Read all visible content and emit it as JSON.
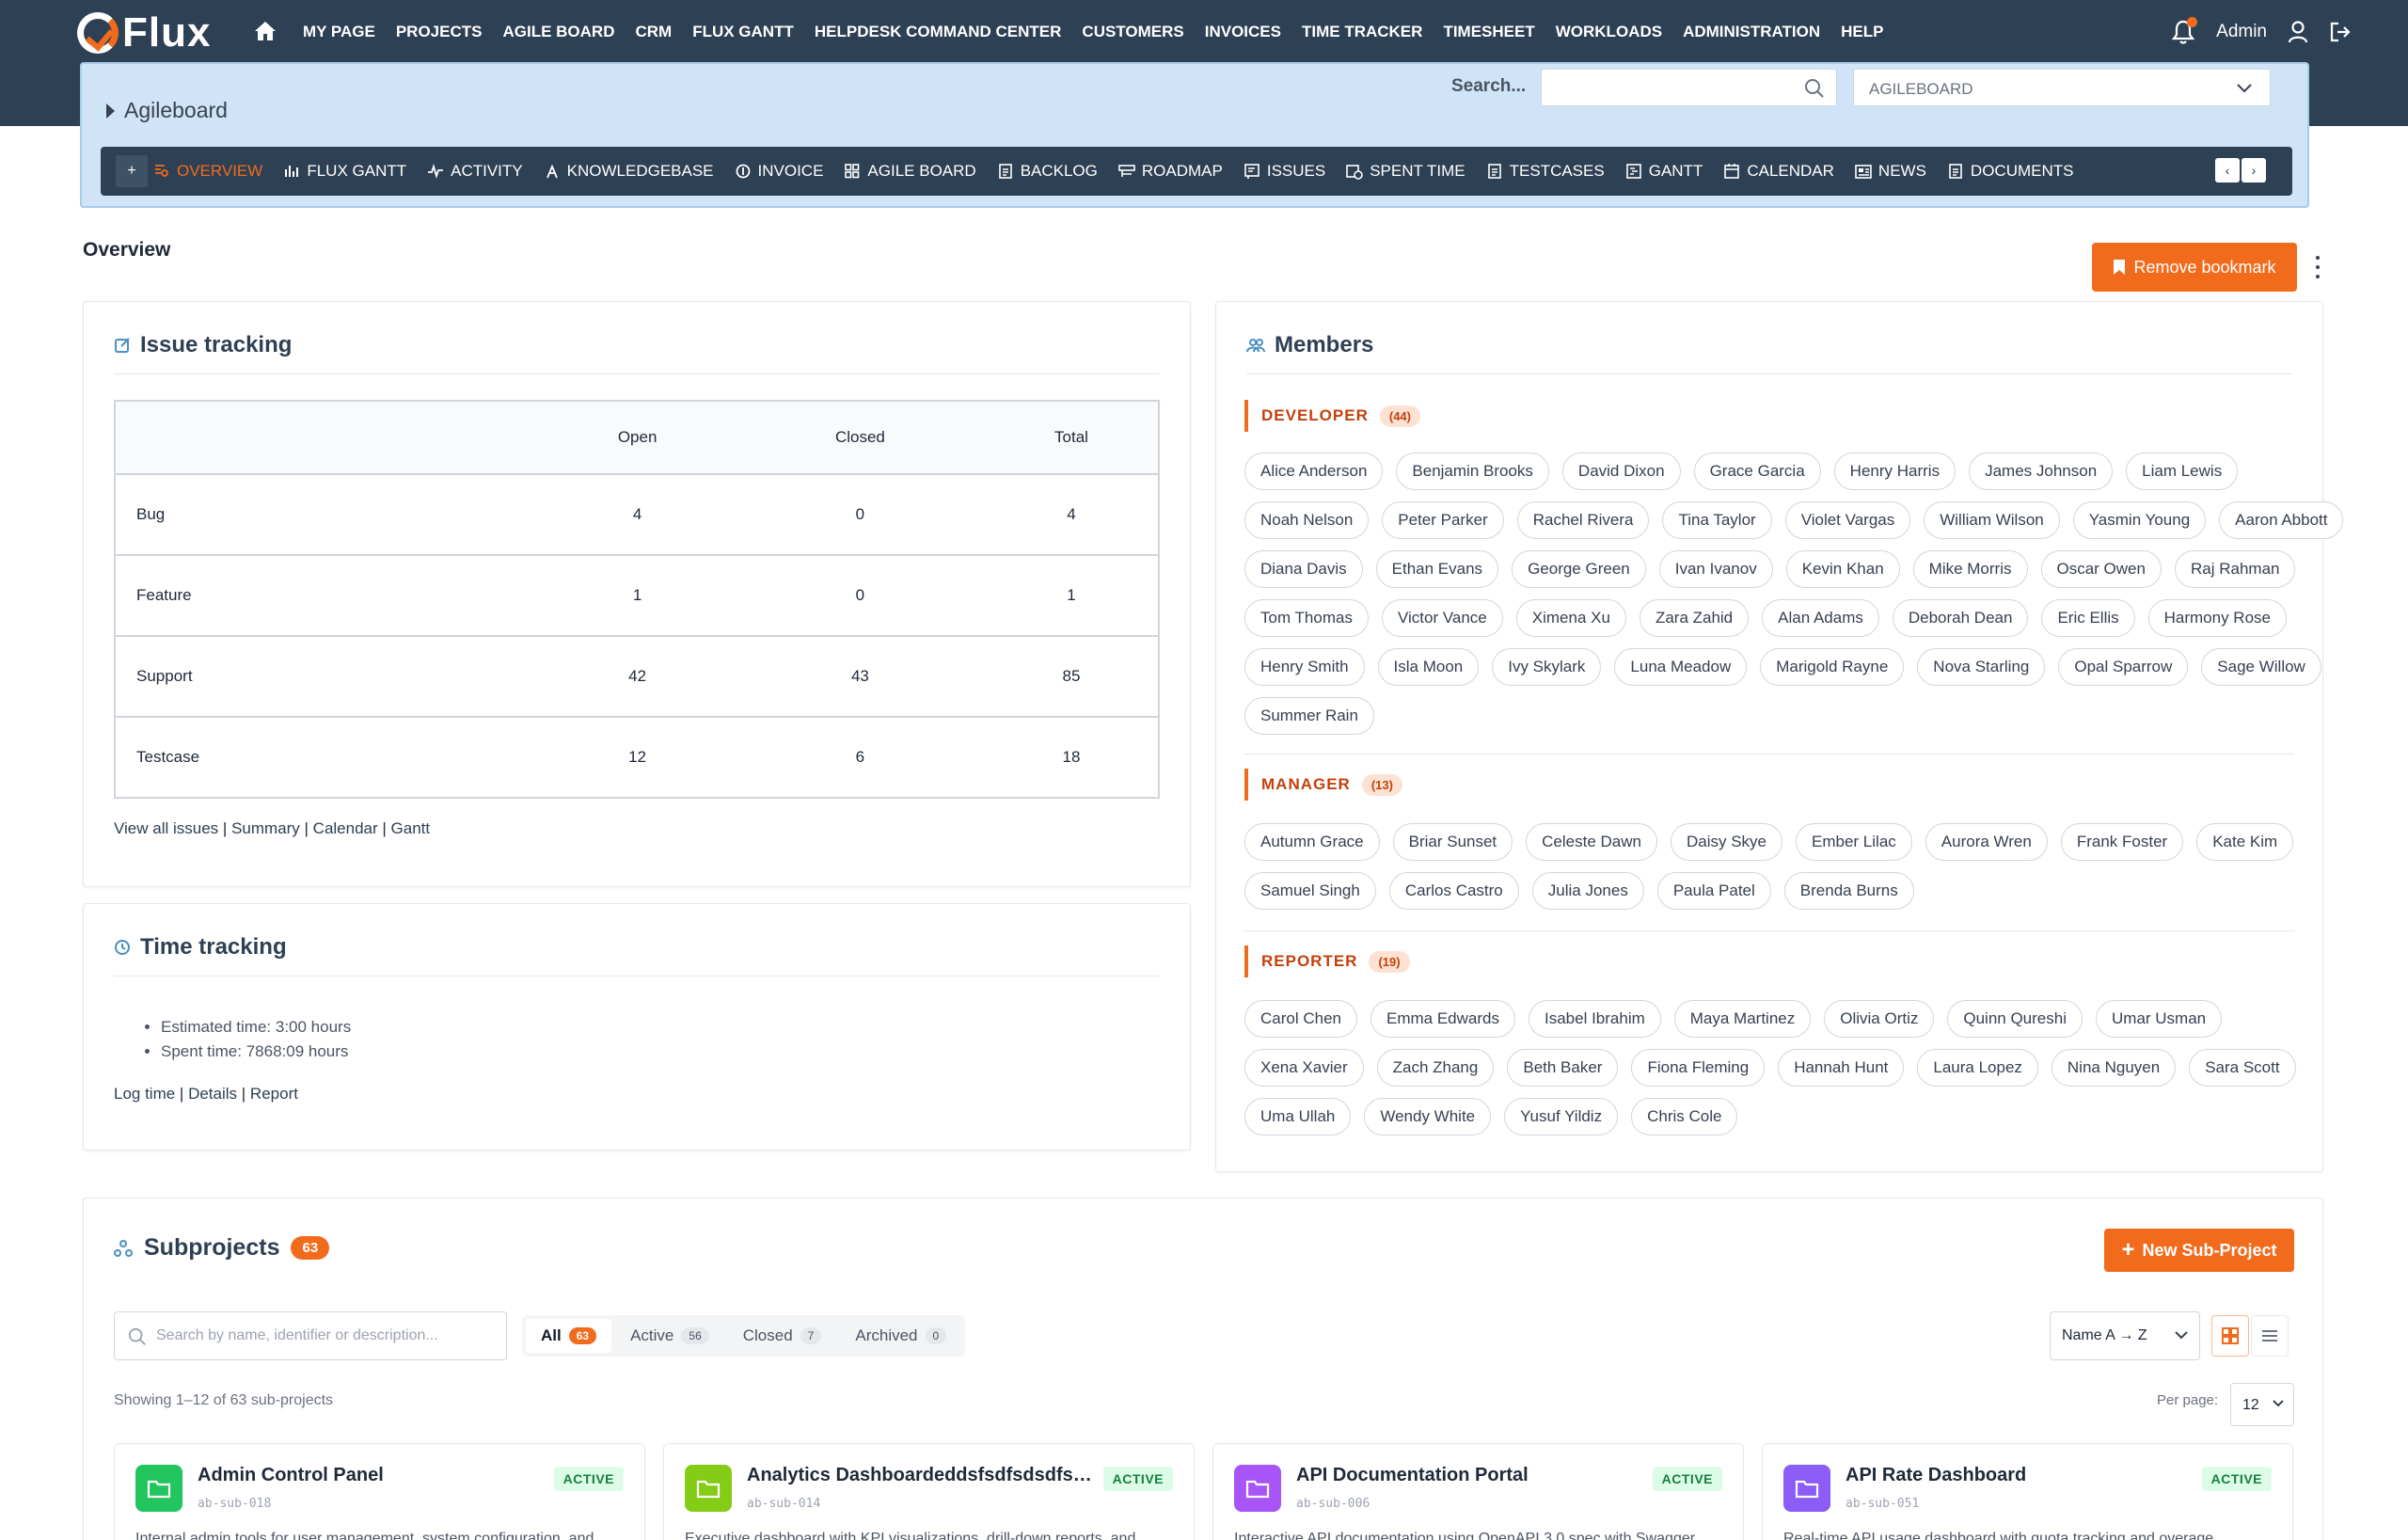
{
  "app": {
    "logo_text": "Flux"
  },
  "nav": {
    "items": [
      "MY PAGE",
      "PROJECTS",
      "AGILE BOARD",
      "CRM",
      "FLUX GANTT",
      "HELPDESK COMMAND CENTER",
      "CUSTOMERS",
      "INVOICES",
      "TIME TRACKER",
      "TIMESHEET",
      "WORKLOADS",
      "ADMINISTRATION",
      "HELP"
    ],
    "user": "Admin"
  },
  "project": {
    "breadcrumb": "Agileboard",
    "search_label": "Search...",
    "search_value": "",
    "select_value": "AGILEBOARD",
    "tabs": [
      {
        "label": "OVERVIEW",
        "icon": "overview-icon"
      },
      {
        "label": "FLUX GANTT",
        "icon": "bar-chart-icon"
      },
      {
        "label": "ACTIVITY",
        "icon": "activity-icon"
      },
      {
        "label": "KNOWLEDGEBASE",
        "icon": "knowledgebase-icon"
      },
      {
        "label": "INVOICE",
        "icon": "invoice-icon"
      },
      {
        "label": "AGILE BOARD",
        "icon": "grid-icon"
      },
      {
        "label": "BACKLOG",
        "icon": "document-icon"
      },
      {
        "label": "ROADMAP",
        "icon": "roadmap-icon"
      },
      {
        "label": "ISSUES",
        "icon": "issues-icon"
      },
      {
        "label": "SPENT TIME",
        "icon": "clock-calendar-icon"
      },
      {
        "label": "TESTCASES",
        "icon": "document-icon"
      },
      {
        "label": "GANTT",
        "icon": "gantt-icon"
      },
      {
        "label": "CALENDAR",
        "icon": "calendar-icon"
      },
      {
        "label": "NEWS",
        "icon": "news-icon"
      },
      {
        "label": "DOCUMENTS",
        "icon": "document-icon"
      }
    ],
    "active_tab": "OVERVIEW",
    "tab_plus": "+",
    "arrow_left": "‹",
    "arrow_right": "›"
  },
  "overview": {
    "title": "Overview",
    "bookmark_label": "Remove bookmark"
  },
  "issue_tracking": {
    "title": "Issue tracking",
    "columns": [
      "",
      "Open",
      "Closed",
      "Total"
    ],
    "rows": [
      {
        "type": "Bug",
        "open": "4",
        "closed": "0",
        "total": "4"
      },
      {
        "type": "Feature",
        "open": "1",
        "closed": "0",
        "total": "1"
      },
      {
        "type": "Support",
        "open": "42",
        "closed": "43",
        "total": "85"
      },
      {
        "type": "Testcase",
        "open": "12",
        "closed": "6",
        "total": "18"
      }
    ],
    "links": [
      "View all issues",
      "Summary",
      "Calendar",
      "Gantt"
    ]
  },
  "time_tracking": {
    "title": "Time tracking",
    "estimated": "Estimated time: 3:00 hours",
    "spent": "Spent time: 7868:09 hours",
    "links": [
      "Log time",
      "Details",
      "Report"
    ]
  },
  "members": {
    "title": "Members",
    "roles": [
      {
        "name": "DEVELOPER",
        "count": "(44)",
        "people": [
          "Alice Anderson",
          "Benjamin Brooks",
          "David Dixon",
          "Grace Garcia",
          "Henry Harris",
          "James Johnson",
          "Liam Lewis",
          "Noah Nelson",
          "Peter Parker",
          "Rachel Rivera",
          "Tina Taylor",
          "Violet Vargas",
          "William Wilson",
          "Yasmin Young",
          "Aaron Abbott",
          "Diana Davis",
          "Ethan Evans",
          "George Green",
          "Ivan Ivanov",
          "Kevin Khan",
          "Mike Morris",
          "Oscar Owen",
          "Raj Rahman",
          "Tom Thomas",
          "Victor Vance",
          "Ximena Xu",
          "Zara Zahid",
          "Alan Adams",
          "Deborah Dean",
          "Eric Ellis",
          "Harmony Rose",
          "Henry Smith",
          "Isla Moon",
          "Ivy Skylark",
          "Luna Meadow",
          "Marigold Rayne",
          "Nova Starling",
          "Opal Sparrow",
          "Sage Willow",
          "Summer Rain"
        ]
      },
      {
        "name": "MANAGER",
        "count": "(13)",
        "people": [
          "Autumn Grace",
          "Briar Sunset",
          "Celeste Dawn",
          "Daisy Skye",
          "Ember Lilac",
          "Aurora Wren",
          "Frank Foster",
          "Kate Kim",
          "Samuel Singh",
          "Carlos Castro",
          "Julia Jones",
          "Paula Patel",
          "Brenda Burns"
        ]
      },
      {
        "name": "REPORTER",
        "count": "(19)",
        "people": [
          "Carol Chen",
          "Emma Edwards",
          "Isabel Ibrahim",
          "Maya Martinez",
          "Olivia Ortiz",
          "Quinn Qureshi",
          "Umar Usman",
          "Xena Xavier",
          "Zach Zhang",
          "Beth Baker",
          "Fiona Fleming",
          "Hannah Hunt",
          "Laura Lopez",
          "Nina Nguyen",
          "Sara Scott",
          "Uma Ullah",
          "Wendy White",
          "Yusuf Yildiz",
          "Chris Cole"
        ]
      }
    ]
  },
  "subprojects": {
    "title": "Subprojects",
    "count": "63",
    "new_button": "New Sub-Project",
    "search_placeholder": "Search by name, identifier or description...",
    "filters": [
      {
        "label": "All",
        "count": "63"
      },
      {
        "label": "Active",
        "count": "56"
      },
      {
        "label": "Closed",
        "count": "7"
      },
      {
        "label": "Archived",
        "count": "0"
      }
    ],
    "sort": "Name A → Z",
    "showing": "Showing 1–12 of 63 sub-projects",
    "per_page_label": "Per page:",
    "per_page": "12",
    "cards": [
      {
        "name": "Admin Control Panel",
        "id": "ab-sub-018",
        "status": "ACTIVE",
        "color": "#22c55e",
        "desc": "Internal admin tools for user management, system configuration, and"
      },
      {
        "name": "Analytics Dashboardeddsfsdfsdsdfsfs...",
        "id": "ab-sub-014",
        "status": "ACTIVE",
        "color": "#84cc16",
        "desc": "Executive dashboard with KPI visualizations, drill-down reports, and"
      },
      {
        "name": "API Documentation Portal",
        "id": "ab-sub-006",
        "status": "ACTIVE",
        "color": "#a855f7",
        "desc": "Interactive API documentation using OpenAPI 3.0 spec with Swagger"
      },
      {
        "name": "API Rate Dashboard",
        "id": "ab-sub-051",
        "status": "ACTIVE",
        "color": "#8b5cf6",
        "desc": "Real-time API usage dashboard with quota tracking and overage"
      }
    ]
  },
  "colors": {
    "brand": "#f26b1d",
    "navy": "#2e4053",
    "panel": "#cfe5f7"
  }
}
